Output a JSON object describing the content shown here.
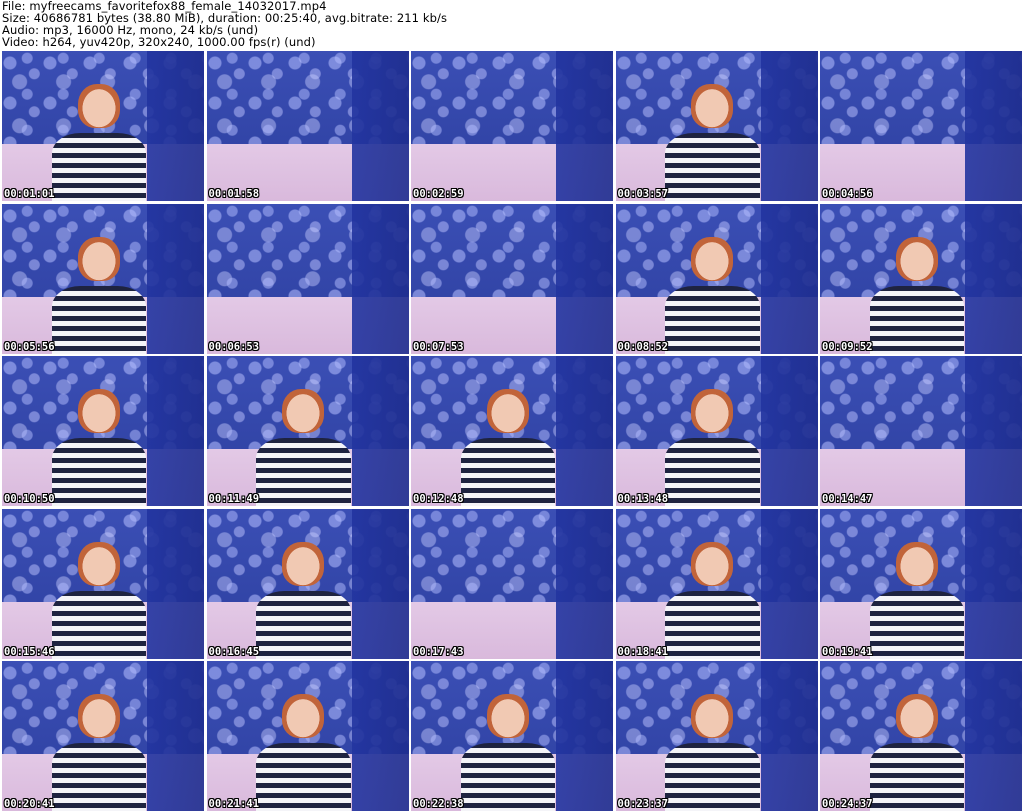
{
  "header": {
    "file_line": "File: myfreecams_favoritefox88_female_14032017.mp4",
    "size_line": "Size: 40686781 bytes (38.80 MiB), duration: 00:25:40, avg.bitrate: 211 kb/s",
    "audio_line": "Audio: mp3, 16000 Hz, mono, 24 kb/s (und)",
    "video_line": "Video: h264, yuv420p, 320x240, 1000.00 fps(r) (und)"
  },
  "thumbnails": [
    {
      "timestamp": "00:01:01",
      "has_person": true
    },
    {
      "timestamp": "00:01:58",
      "has_person": false
    },
    {
      "timestamp": "00:02:59",
      "has_person": false
    },
    {
      "timestamp": "00:03:57",
      "has_person": true
    },
    {
      "timestamp": "00:04:56",
      "has_person": false
    },
    {
      "timestamp": "00:05:56",
      "has_person": true
    },
    {
      "timestamp": "00:06:53",
      "has_person": false
    },
    {
      "timestamp": "00:07:53",
      "has_person": false
    },
    {
      "timestamp": "00:08:52",
      "has_person": true
    },
    {
      "timestamp": "00:09:52",
      "has_person": true
    },
    {
      "timestamp": "00:10:50",
      "has_person": true
    },
    {
      "timestamp": "00:11:49",
      "has_person": true
    },
    {
      "timestamp": "00:12:48",
      "has_person": true
    },
    {
      "timestamp": "00:13:48",
      "has_person": true
    },
    {
      "timestamp": "00:14:47",
      "has_person": false
    },
    {
      "timestamp": "00:15:46",
      "has_person": true
    },
    {
      "timestamp": "00:16:45",
      "has_person": true
    },
    {
      "timestamp": "00:17:43",
      "has_person": false
    },
    {
      "timestamp": "00:18:41",
      "has_person": true
    },
    {
      "timestamp": "00:19:41",
      "has_person": true
    },
    {
      "timestamp": "00:20:41",
      "has_person": true
    },
    {
      "timestamp": "00:21:41",
      "has_person": true
    },
    {
      "timestamp": "00:22:38",
      "has_person": true
    },
    {
      "timestamp": "00:23:37",
      "has_person": true
    },
    {
      "timestamp": "00:24:37",
      "has_person": true
    }
  ]
}
